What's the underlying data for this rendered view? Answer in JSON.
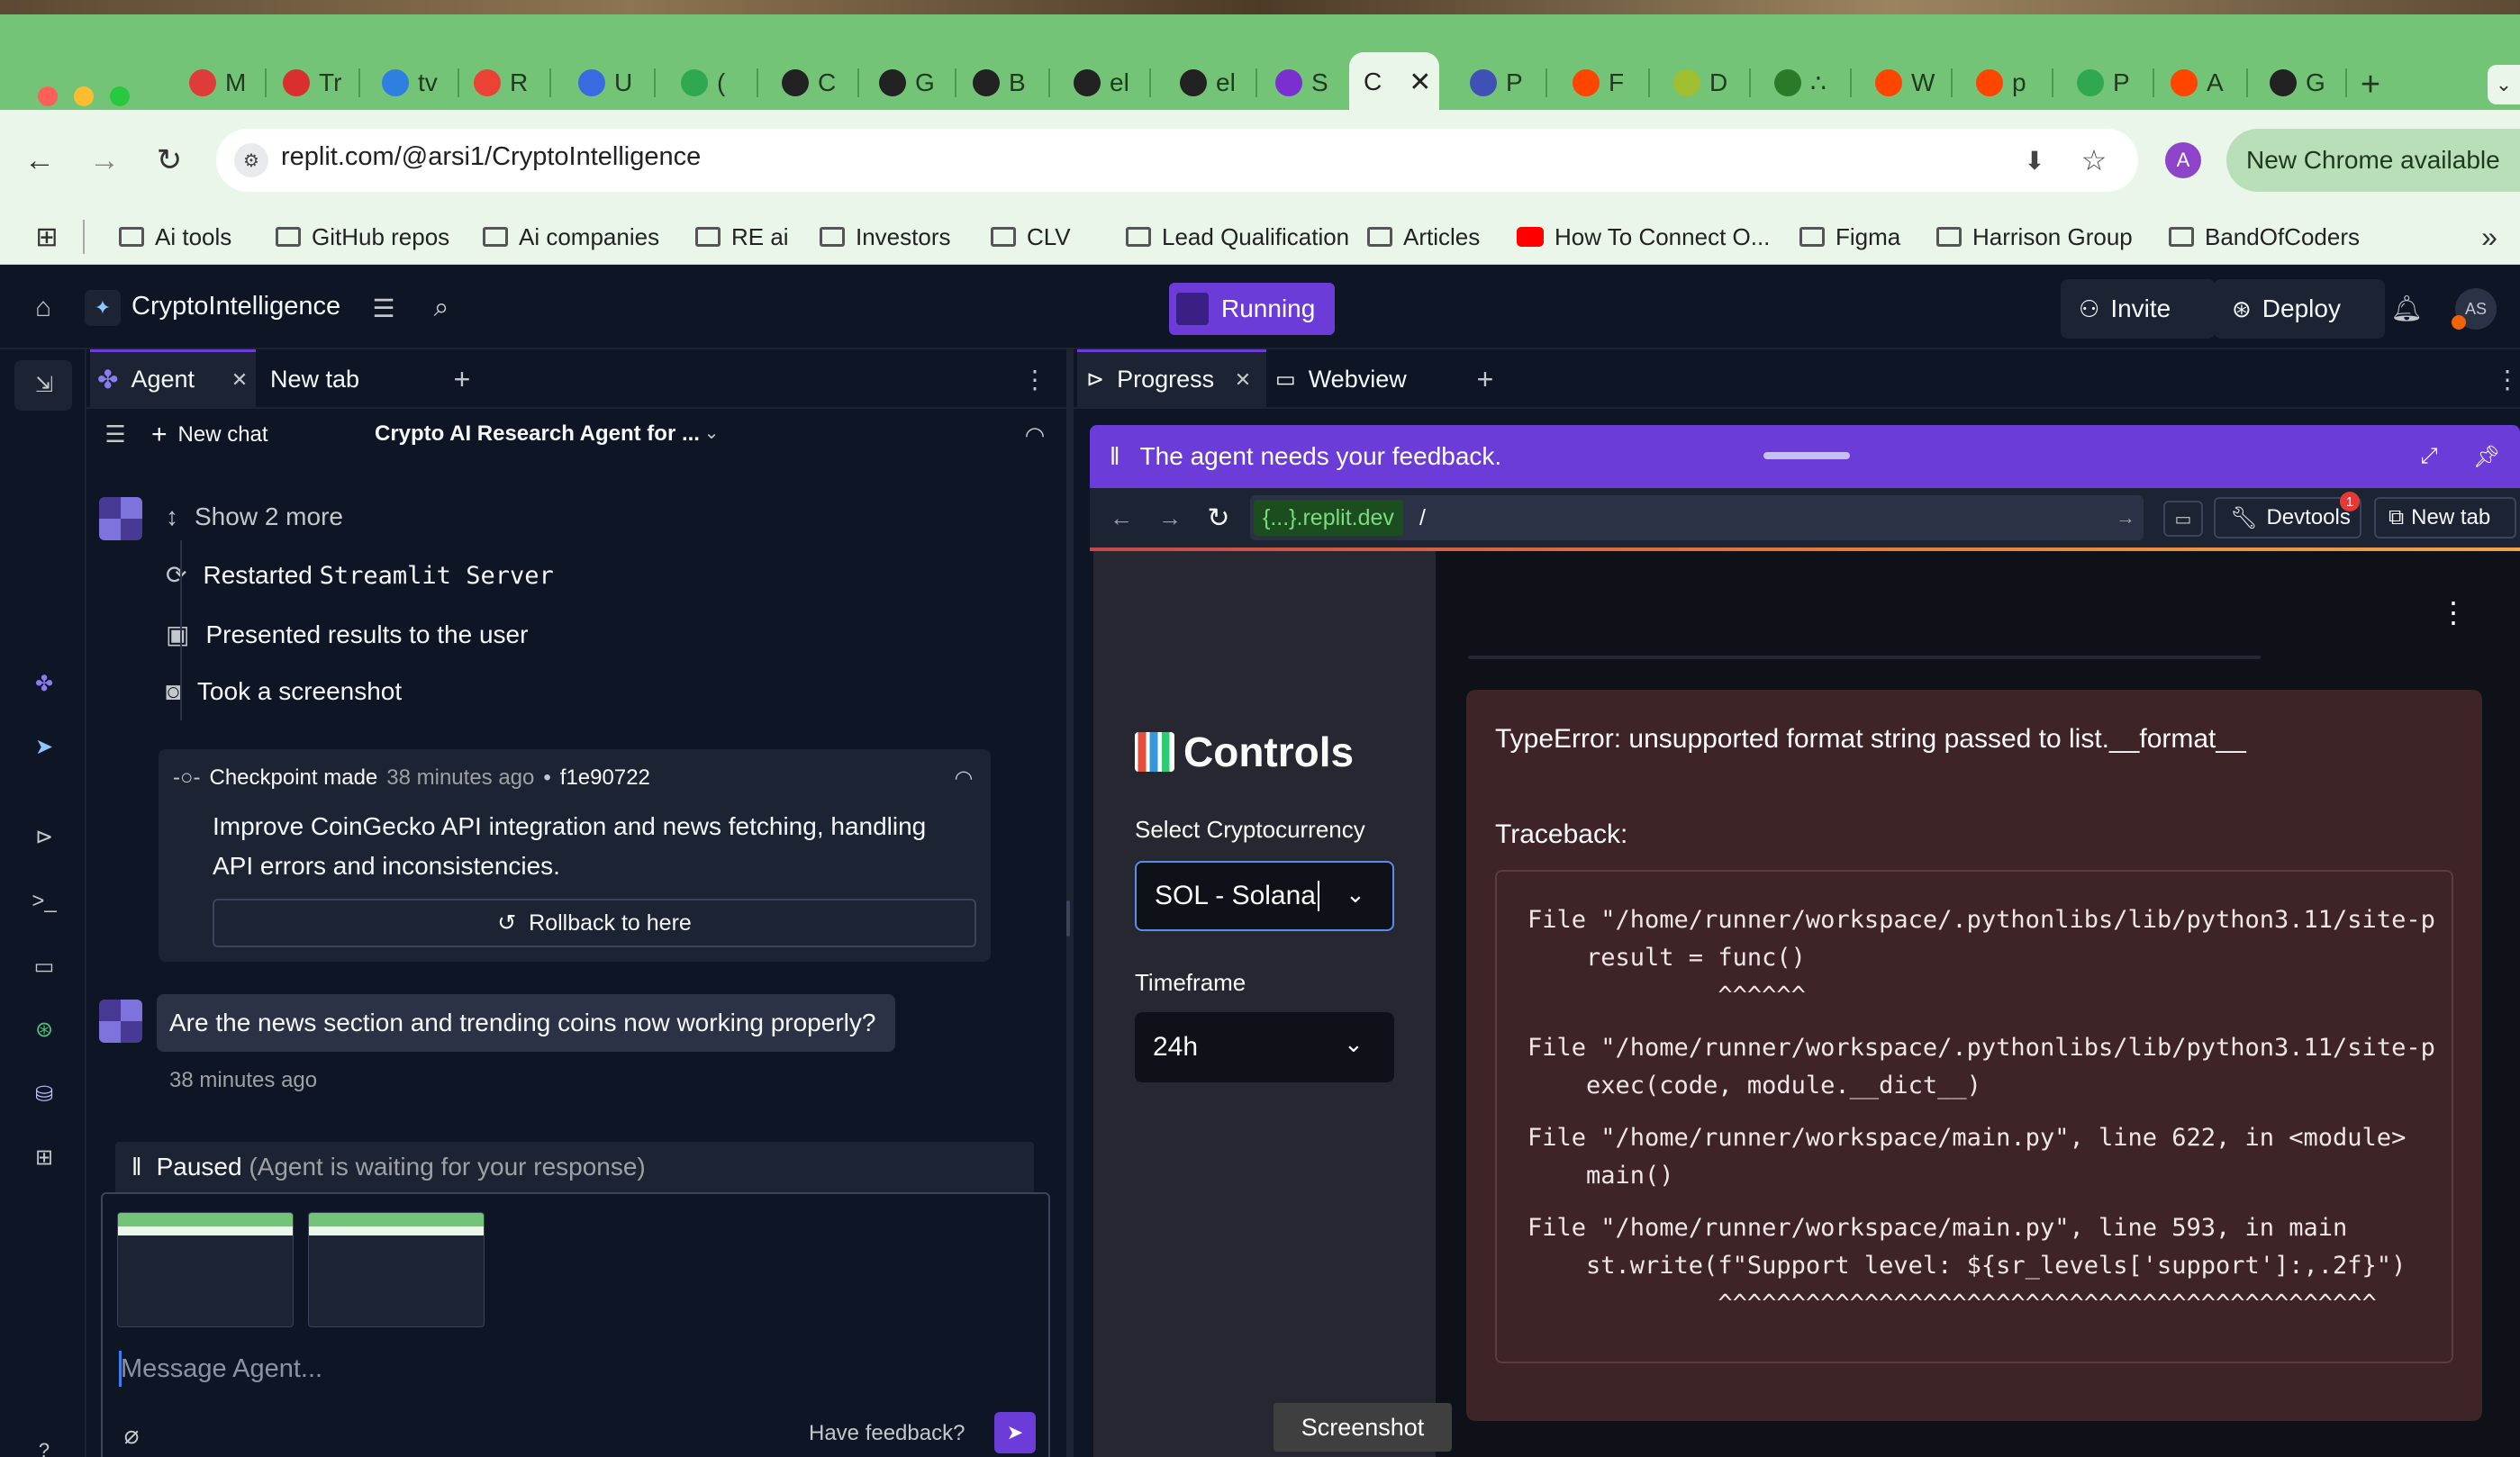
{
  "browser": {
    "tabs": [
      {
        "letter": "M",
        "color": "#e03b3b"
      },
      {
        "letter": "Tr",
        "color": "#d9302f"
      },
      {
        "letter": "tv",
        "color": "#2f7fe0"
      },
      {
        "letter": "R",
        "color": "#ea4335"
      },
      {
        "letter": "U",
        "color": "#3a6ae0"
      },
      {
        "letter": "(",
        "color": "#2fa84f"
      },
      {
        "letter": "C",
        "color": "#222222"
      },
      {
        "letter": "G",
        "color": "#222222"
      },
      {
        "letter": "B",
        "color": "#222222"
      },
      {
        "letter": "el",
        "color": "#222222"
      },
      {
        "letter": "el",
        "color": "#222222"
      },
      {
        "letter": "S",
        "color": "#7b2fd0"
      },
      {
        "letter": "P",
        "color": "#3f51b5"
      },
      {
        "letter": "F",
        "color": "#ff4500"
      },
      {
        "letter": "D",
        "color": "#9fbf30"
      },
      {
        "letter": "∴",
        "color": "#2a7a2a"
      },
      {
        "letter": "W",
        "color": "#ff4500"
      },
      {
        "letter": "p",
        "color": "#ff4500"
      },
      {
        "letter": "P",
        "color": "#2fa84f"
      },
      {
        "letter": "A",
        "color": "#ff4500"
      },
      {
        "letter": "G",
        "color": "#222222"
      }
    ],
    "active_tab": {
      "label": "C"
    },
    "url": "replit.com/@arsi1/CryptoIntelligence",
    "new_chrome": "New Chrome available",
    "profile_initial": "A",
    "bookmarks": [
      {
        "label": "Ai tools"
      },
      {
        "label": "GitHub repos"
      },
      {
        "label": "Ai companies"
      },
      {
        "label": "RE ai"
      },
      {
        "label": "Investors"
      },
      {
        "label": "CLV"
      },
      {
        "label": "Lead Qualification"
      },
      {
        "label": "Articles"
      },
      {
        "label": "How To Connect O..."
      },
      {
        "label": "Figma"
      },
      {
        "label": "Harrison Group"
      },
      {
        "label": "BandOfCoders"
      }
    ],
    "colors": {
      "tabbar": "#74c478",
      "toolbar": "#eaf6ea"
    }
  },
  "app": {
    "project_name": "CryptoIntelligence",
    "run_label": "Running",
    "invite_label": "Invite",
    "deploy_label": "Deploy",
    "avatar_initials": "AS",
    "colors": {
      "accent": "#6c3cd9",
      "bg": "#0e1525",
      "surface": "#1c2333"
    }
  },
  "left_pane": {
    "tabs": [
      {
        "label": "Agent"
      },
      {
        "label": "New tab"
      }
    ],
    "new_chat": "New chat",
    "chat_title": "Crypto AI Research Agent for ...",
    "show_more": "Show 2 more",
    "steps": [
      {
        "text": "Restarted ",
        "code": "Streamlit Server"
      },
      {
        "text": "Presented results to the user",
        "code": ""
      },
      {
        "text": "Took a screenshot",
        "code": ""
      }
    ],
    "checkpoint": {
      "label": "Checkpoint made",
      "time": "38 minutes ago",
      "hash": "f1e90722",
      "message": "Improve CoinGecko API integration and news fetching, handling API errors and inconsistencies.",
      "rollback": "Rollback to here"
    },
    "user_message": "Are the news section and trending coins now working properly?",
    "user_time": "38 minutes ago",
    "paused": "Paused",
    "paused_detail": "(Agent is waiting for your response)",
    "input_placeholder": "Message Agent...",
    "feedback": "Have feedback?"
  },
  "right_pane": {
    "tabs": [
      {
        "label": "Progress"
      },
      {
        "label": "Webview"
      }
    ],
    "feedback_banner": "The agent needs your feedback.",
    "domain": "{...}.replit.dev",
    "path": "/",
    "devtools": "Devtools",
    "devtools_badge": "1",
    "new_tab": "New tab",
    "sidebar": {
      "heading": "Controls",
      "select_label": "Select Cryptocurrency",
      "select_value": "SOL - Solana",
      "timeframe_label": "Timeframe",
      "timeframe_value": "24h"
    },
    "error": {
      "type": "TypeError",
      "message": ": unsupported format string passed to list.__format__",
      "traceback_label": "Traceback:",
      "lines": [
        "File \"/home/runner/workspace/.pythonlibs/lib/python3.11/site-p",
        "    result = func()",
        "             ^^^^^^",
        "File \"/home/runner/workspace/.pythonlibs/lib/python3.11/site-p",
        "    exec(code, module.__dict__)",
        "File \"/home/runner/workspace/main.py\", line 622, in <module>",
        "    main()",
        "File \"/home/runner/workspace/main.py\", line 593, in main",
        "    st.write(f\"Support level: ${sr_levels['support']:,.2f}\")",
        "             ^^^^^^^^^^^^^^^^^^^^^^^^^^^^^^^^^^^^^^^^^^^^^"
      ]
    },
    "tooltip": "Screenshot"
  }
}
